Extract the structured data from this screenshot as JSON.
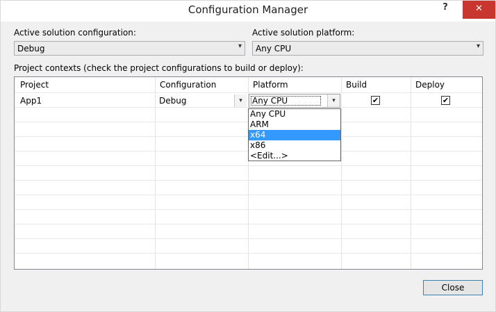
{
  "window": {
    "title": "Configuration Manager",
    "help_glyph": "?",
    "close_glyph": "✕"
  },
  "solution_config": {
    "label": "Active solution configuration:",
    "value": "Debug"
  },
  "solution_platform": {
    "label": "Active solution platform:",
    "value": "Any CPU"
  },
  "project_contexts": {
    "label": "Project contexts (check the project configurations to build or deploy):",
    "columns": [
      "Project",
      "Configuration",
      "Platform",
      "Build",
      "Deploy"
    ],
    "rows": [
      {
        "project": "App1",
        "configuration": "Debug",
        "platform": "Any CPU",
        "build_checked": true,
        "deploy_checked": true
      }
    ]
  },
  "platform_dropdown": {
    "options": [
      "Any CPU",
      "ARM",
      "x64",
      "x86",
      "<Edit...>"
    ],
    "highlighted": "x64"
  },
  "check_glyph": "✔",
  "arrow_glyph": "▾",
  "buttons": {
    "close_label": "Close"
  },
  "colors": {
    "selection": "#3399ff",
    "close_x_bg": "#c7372f",
    "button_border": "#3c7fb1"
  }
}
